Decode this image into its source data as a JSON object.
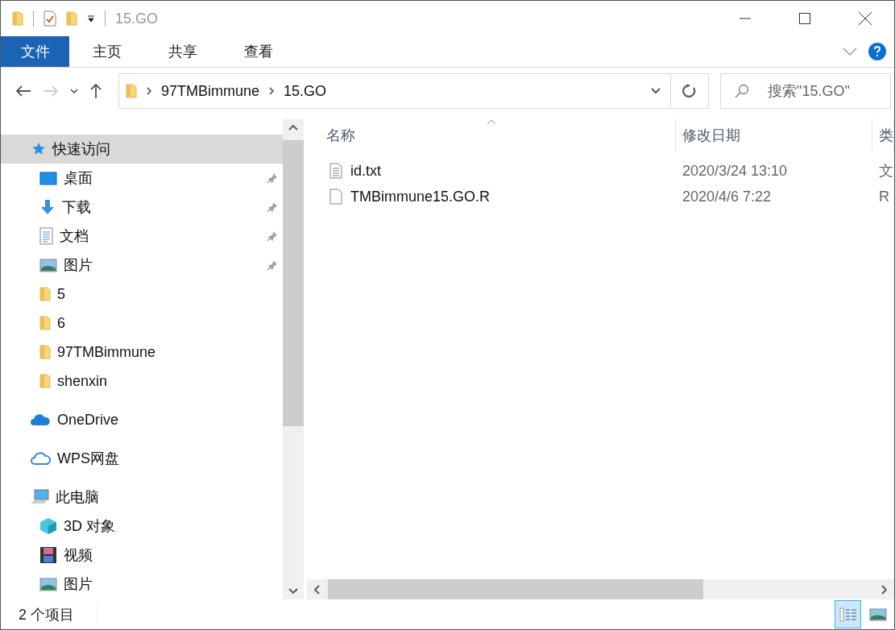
{
  "window": {
    "title": "15.GO"
  },
  "ribbon": {
    "tabs": [
      {
        "label": "文件",
        "kind": "file"
      },
      {
        "label": "主页",
        "kind": "tab"
      },
      {
        "label": "共享",
        "kind": "tab"
      },
      {
        "label": "查看",
        "kind": "tab"
      }
    ]
  },
  "address": {
    "path": [
      "97TMBimmune",
      "15.GO"
    ],
    "search": {
      "placeholder": "搜索\"15.GO\""
    }
  },
  "sidebar": {
    "groups": [
      {
        "label": "快速访问",
        "kind": "quick",
        "selected": true,
        "children": [
          {
            "label": "桌面",
            "kind": "desktop",
            "pinned": true,
            "selected": false
          },
          {
            "label": "下载",
            "kind": "downloads",
            "pinned": true,
            "selected": false
          },
          {
            "label": "文档",
            "kind": "documents",
            "pinned": true,
            "selected": false
          },
          {
            "label": "图片",
            "kind": "pictures",
            "pinned": true,
            "selected": false
          },
          {
            "label": "5",
            "kind": "folder",
            "pinned": false,
            "selected": false
          },
          {
            "label": "6",
            "kind": "folder",
            "pinned": false,
            "selected": false
          },
          {
            "label": "97TMBimmune",
            "kind": "folder",
            "pinned": false,
            "selected": false
          },
          {
            "label": "shenxin",
            "kind": "folder",
            "pinned": false,
            "selected": false
          }
        ]
      },
      {
        "label": "OneDrive",
        "kind": "onedrive",
        "selected": false
      },
      {
        "label": "WPS网盘",
        "kind": "cloud",
        "selected": false
      },
      {
        "label": "此电脑",
        "kind": "computer",
        "selected": false,
        "children": [
          {
            "label": "3D 对象",
            "kind": "cube",
            "pinned": false,
            "selected": false
          },
          {
            "label": "视频",
            "kind": "video",
            "pinned": false,
            "selected": false
          },
          {
            "label": "图片",
            "kind": "pictures",
            "pinned": false,
            "selected": false
          }
        ]
      }
    ]
  },
  "file_list": {
    "columns": [
      {
        "label": "名称",
        "sorted": true
      },
      {
        "label": "修改日期",
        "sorted": false
      },
      {
        "label": "类",
        "sorted": false
      }
    ],
    "rows": [
      {
        "name": "id.txt",
        "kind": "text",
        "date": "2020/3/24 13:10",
        "column_3": "文"
      },
      {
        "name": "TMBimmune15.GO.R",
        "kind": "blank",
        "date": "2020/4/6 7:22",
        "column_3": "R"
      }
    ]
  },
  "status_bar": {
    "count": "2 个项目",
    "views": [
      {
        "kind": "details",
        "selected": true
      },
      {
        "kind": "large-icons",
        "selected": false
      }
    ]
  }
}
